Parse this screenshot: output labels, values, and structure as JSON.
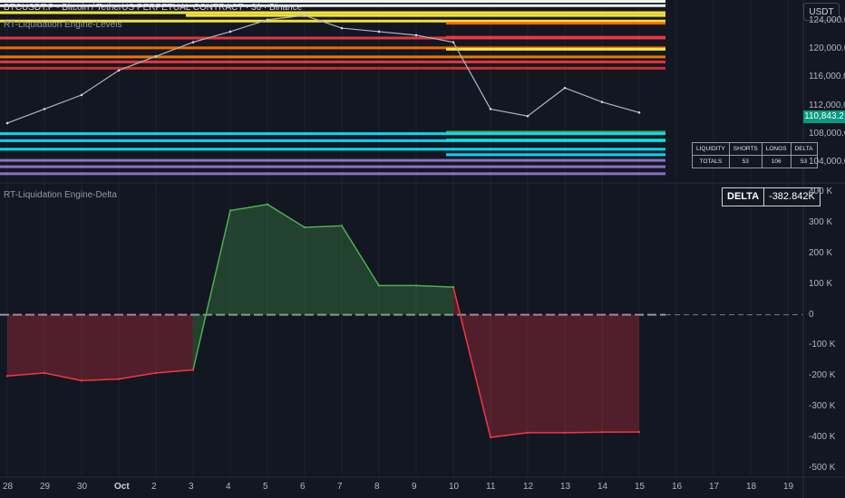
{
  "header": {
    "title": "BTCUSDT.P · Bitcoin / TetherUS PERPETUAL CONTRACT · 30 · Binance",
    "indicator_levels": "RT-Liquidation Engine-Levels",
    "indicator_delta": "RT-Liquidation Engine-Delta",
    "currency_button": "USDT"
  },
  "price_axis": {
    "ticks": [
      "124,000.0",
      "120,000.0",
      "116,000.0",
      "112,000.0",
      "108,000.0",
      "104,000.0"
    ],
    "last_price": "110,843.2"
  },
  "delta_axis": {
    "ticks": [
      "400 K",
      "300 K",
      "200 K",
      "100 K",
      "0",
      "-100 K",
      "-200 K",
      "-300 K",
      "-400 K",
      "-500 K"
    ]
  },
  "time_axis": {
    "ticks": [
      "28",
      "29",
      "30",
      "Oct",
      "2",
      "3",
      "4",
      "5",
      "6",
      "7",
      "8",
      "9",
      "10",
      "11",
      "12",
      "13",
      "14",
      "15",
      "16",
      "17",
      "18",
      "19"
    ]
  },
  "delta_readout": {
    "label": "DELTA",
    "value": "-382.842K"
  },
  "liquidity_table": {
    "headers": [
      "LIQUIDITY",
      "SHORTS",
      "LONGS",
      "DELTA"
    ],
    "rows": [
      [
        "TOTALS",
        "53",
        "106",
        "53"
      ]
    ]
  },
  "colors": {
    "background": "#131722",
    "up": "#4caf50",
    "down": "#f23645",
    "last_price_badge": "#089981"
  },
  "chart_data": [
    {
      "type": "line",
      "title": "BTCUSDT.P · Bitcoin / TetherUS PERPETUAL CONTRACT · 30 · Binance",
      "x": [
        "28",
        "29",
        "30",
        "Oct",
        "2",
        "3",
        "4",
        "5",
        "6",
        "7",
        "8",
        "9",
        "10",
        "11",
        "12",
        "13",
        "14",
        "15"
      ],
      "series": [
        {
          "values": [
            109500,
            111500,
            113500,
            117000,
            119000,
            121000,
            122500,
            124200,
            124800,
            123000,
            122500,
            122000,
            121000,
            111500,
            110500,
            114500,
            112500,
            111000
          ]
        }
      ],
      "ylim": [
        101000,
        127000
      ],
      "liquidation_levels": [
        {
          "from": "28",
          "price": 126800,
          "color": "#ffffff"
        },
        {
          "from": "28",
          "price": 126200,
          "color": "#ffffff"
        },
        {
          "from": "28",
          "price": 125200,
          "color": "#ffeb3b"
        },
        {
          "from": "3",
          "price": 124800,
          "color": "#ffeb3b"
        },
        {
          "from": "28",
          "price": 124000,
          "color": "#ffeb3b"
        },
        {
          "from": "28",
          "price": 121600,
          "color": "#f23645"
        },
        {
          "from": "28",
          "price": 120200,
          "color": "#ff6d00"
        },
        {
          "from": "28",
          "price": 118900,
          "color": "#f57c00"
        },
        {
          "from": "28",
          "price": 118200,
          "color": "#f23645"
        },
        {
          "from": "28",
          "price": 117300,
          "color": "#d32f2f"
        },
        {
          "from": "10",
          "price": 123700,
          "color": "#ff6d00"
        },
        {
          "from": "10",
          "price": 121700,
          "color": "#f23645"
        },
        {
          "from": "10",
          "price": 120000,
          "color": "#ffeb3b"
        },
        {
          "from": "10",
          "price": 108200,
          "color": "#4caf50"
        },
        {
          "from": "10",
          "price": 107100,
          "color": "#00e676"
        },
        {
          "from": "10",
          "price": 105000,
          "color": "#00e5ff"
        },
        {
          "from": "28",
          "price": 108000,
          "color": "#00e5ff"
        },
        {
          "from": "28",
          "price": 107000,
          "color": "#00e5ff"
        },
        {
          "from": "28",
          "price": 105800,
          "color": "#00e5ff"
        },
        {
          "from": "28",
          "price": 104200,
          "color": "#9575cd"
        },
        {
          "from": "28",
          "price": 103300,
          "color": "#9575cd"
        },
        {
          "from": "28",
          "price": 102300,
          "color": "#9575cd"
        }
      ]
    },
    {
      "type": "area",
      "title": "RT-Liquidation Engine-Delta",
      "x": [
        "28",
        "29",
        "30",
        "Oct",
        "2",
        "3",
        "4",
        "5",
        "6",
        "7",
        "8",
        "9",
        "10",
        "11",
        "12",
        "13",
        "14",
        "15"
      ],
      "series": [
        {
          "name": "DELTA",
          "values": [
            -200000,
            -190000,
            -215000,
            -210000,
            -190000,
            -180000,
            340000,
            360000,
            285000,
            290000,
            95000,
            95000,
            90000,
            -400000,
            -385000,
            -385000,
            -383000,
            -382842
          ]
        }
      ],
      "ylim": [
        -530000,
        430000
      ],
      "zero_line": true
    }
  ]
}
